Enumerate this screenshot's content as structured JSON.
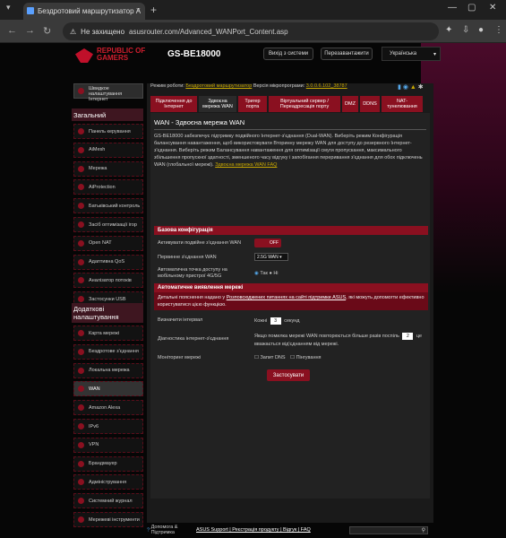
{
  "browser": {
    "tab_title": "Бездротовий маршрутизатор A",
    "address_warning": "Не захищено",
    "url": "asusrouter.com/Advanced_WANPort_Content.asp"
  },
  "header": {
    "brand": "REPUBLIC OF GAMERS",
    "model": "GS-BE18000",
    "logout": "Вихід з системи",
    "reboot": "Перезавантажити",
    "language": "Українська"
  },
  "info": {
    "mode_label": "Режим роботи:",
    "mode_value": "Бездротовий маршрутизатор",
    "fw_label": "Версія мікропрограми:",
    "fw_value": "3.0.0.6.102_38787"
  },
  "sidebar": {
    "quick_setup": "Швидкое налаштування Інтернет",
    "section_general": "Загальний",
    "general_items": [
      "Панель керування",
      "AiMesh",
      "Мережа",
      "AiProtection",
      "Батьківський контроль",
      "Засіб оптимізації ігор",
      "Open NAT",
      "Адаптивна QoS",
      "Аналізатор потоків",
      "Застосунки USB"
    ],
    "section_advanced": "Додаткові налаштування",
    "advanced_items": [
      "Карта мережі",
      "Бездротове з'єднання",
      "Локальна мережа",
      "WAN",
      "Amazon Alexa",
      "IPv6",
      "VPN",
      "Брандмауер",
      "Адміністрування",
      "Системний журнал",
      "Мережеві інструменти"
    ]
  },
  "tabs": [
    "Підключення до Інтернет",
    "Здвоєна мережа WAN",
    "Тригер порта",
    "Віртуальний сервер / Переадресація порту",
    "DMZ",
    "DDNS",
    "NAT-тунелювання"
  ],
  "content": {
    "title": "WAN - Здвоєна мережа WAN",
    "description": "GS-BE18000 забезпечує підтримку подвійного Інтернет-з'єднання (Dual-WAN). Виберіть режим Конфігурація балансування навантаження, щоб використовувати Вторинну мережу WAN для доступу до резервного Інтернет-з'єднання. Виберіть режим Балансування навантаження для оптимізації смуги пропускання, максимального збільшення пропускної здатності, зменшеного часу відгуку і запобігання переривання з'єднання для обох підключень WAN (глобальної мережі).",
    "faq_link": "Здвоєна мережа WAN FAQ",
    "basic_config": "Базова конфігурація",
    "enable_dual_label": "Активувати подвійне з'єднання WAN",
    "enable_dual_value": "OFF",
    "primary_label": "Первинне з'єднання WAN",
    "primary_value": "2.5G WAN",
    "auto_label": "Автоматична точка доступу на мобільному пристрої 4G/5G",
    "auto_yes": "Так",
    "auto_no": "Ні",
    "network_detection": "Автоматичне виявлення мережі",
    "notice_pre": "Детальні пояснення надано у",
    "notice_link": "Розповсюджених питаннях на сайті підтримки ASUS",
    "notice_post": ", які можуть допомогти ефективно користуватися цією функцією.",
    "interval_label": "Визначити інтервал",
    "interval_prefix": "Кожні",
    "interval_value": "3",
    "interval_suffix": "секунд",
    "diag_label": "Діагностика інтернет-з'єднання",
    "diag_text1": "Якщо помилка мережі WAN повторюється більше разів поспіль",
    "diag_value": "2",
    "diag_text2": "це вважається від'єднанням від мережі.",
    "monitor_label": "Моніторинг мережі",
    "monitor_dns": "Запит DNS",
    "monitor_ping": "Пінгування",
    "apply": "Застосувати"
  },
  "footer": {
    "help": "Допомога & Підтримка",
    "links": "ASUS Support | Реєстрація продукту | Відгук | FAQ"
  }
}
